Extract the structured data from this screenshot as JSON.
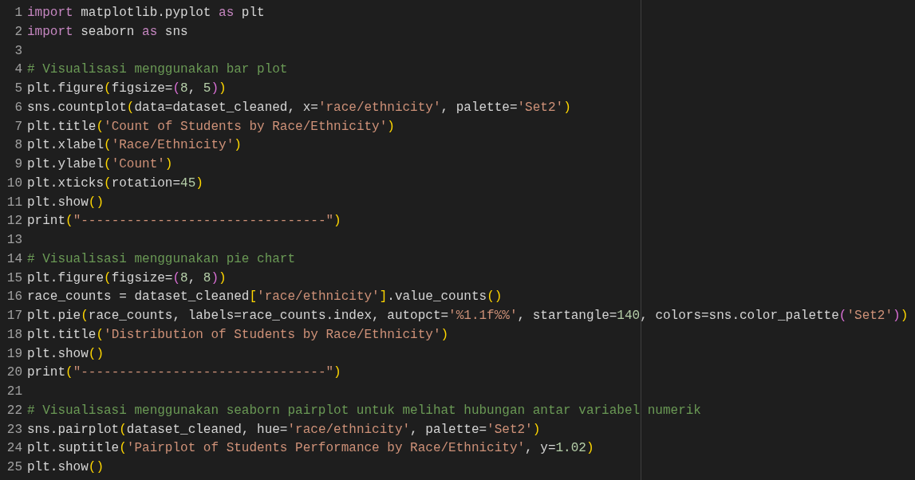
{
  "editor": {
    "lines": [
      {
        "number": "1",
        "tokens": [
          {
            "text": "import",
            "kind": "keyword"
          },
          {
            "text": " matplotlib.pyplot ",
            "kind": "plain"
          },
          {
            "text": "as",
            "kind": "keyword"
          },
          {
            "text": " plt",
            "kind": "plain"
          }
        ]
      },
      {
        "number": "2",
        "tokens": [
          {
            "text": "import",
            "kind": "keyword"
          },
          {
            "text": " seaborn ",
            "kind": "plain"
          },
          {
            "text": "as",
            "kind": "keyword"
          },
          {
            "text": " sns",
            "kind": "plain"
          }
        ]
      },
      {
        "number": "3"
      },
      {
        "number": "4",
        "tokens": [
          {
            "text": "# Visualisasi menggunakan bar plot",
            "kind": "comment"
          }
        ]
      },
      {
        "number": "5",
        "tokens": [
          {
            "text": "plt.figure",
            "kind": "plain"
          },
          {
            "text": "(",
            "kind": "paren"
          },
          {
            "text": "figsize=",
            "kind": "plain"
          },
          {
            "text": "(",
            "kind": "subparen"
          },
          {
            "text": "8",
            "kind": "number"
          },
          {
            "text": ", ",
            "kind": "plain"
          },
          {
            "text": "5",
            "kind": "number"
          },
          {
            "text": ")",
            "kind": "subparen"
          },
          {
            "text": ")",
            "kind": "paren"
          }
        ]
      },
      {
        "number": "6",
        "tokens": [
          {
            "text": "sns.countplot",
            "kind": "plain"
          },
          {
            "text": "(",
            "kind": "paren"
          },
          {
            "text": "data=dataset_cleaned, x=",
            "kind": "plain"
          },
          {
            "text": "'race/ethnicity'",
            "kind": "string"
          },
          {
            "text": ", palette=",
            "kind": "plain"
          },
          {
            "text": "'Set2'",
            "kind": "string"
          },
          {
            "text": ")",
            "kind": "paren"
          }
        ]
      },
      {
        "number": "7",
        "tokens": [
          {
            "text": "plt.title",
            "kind": "plain"
          },
          {
            "text": "(",
            "kind": "paren"
          },
          {
            "text": "'Count of Students by Race/Ethnicity'",
            "kind": "string"
          },
          {
            "text": ")",
            "kind": "paren"
          }
        ]
      },
      {
        "number": "8",
        "tokens": [
          {
            "text": "plt.xlabel",
            "kind": "plain"
          },
          {
            "text": "(",
            "kind": "paren"
          },
          {
            "text": "'Race/Ethnicity'",
            "kind": "string"
          },
          {
            "text": ")",
            "kind": "paren"
          }
        ]
      },
      {
        "number": "9",
        "tokens": [
          {
            "text": "plt.ylabel",
            "kind": "plain"
          },
          {
            "text": "(",
            "kind": "paren"
          },
          {
            "text": "'Count'",
            "kind": "string"
          },
          {
            "text": ")",
            "kind": "paren"
          }
        ]
      },
      {
        "number": "10",
        "tokens": [
          {
            "text": "plt.xticks",
            "kind": "plain"
          },
          {
            "text": "(",
            "kind": "paren"
          },
          {
            "text": "rotation=",
            "kind": "plain"
          },
          {
            "text": "45",
            "kind": "number"
          },
          {
            "text": ")",
            "kind": "paren"
          }
        ]
      },
      {
        "number": "11",
        "tokens": [
          {
            "text": "plt.show",
            "kind": "plain"
          },
          {
            "text": "()",
            "kind": "paren"
          }
        ]
      },
      {
        "number": "12",
        "tokens": [
          {
            "text": "print",
            "kind": "plain"
          },
          {
            "text": "(",
            "kind": "paren"
          },
          {
            "text": "\"--------------------------------\"",
            "kind": "string"
          },
          {
            "text": ")",
            "kind": "paren"
          }
        ]
      },
      {
        "number": "13"
      },
      {
        "number": "14",
        "tokens": [
          {
            "text": "# Visualisasi menggunakan pie chart",
            "kind": "comment"
          }
        ]
      },
      {
        "number": "15",
        "tokens": [
          {
            "text": "plt.figure",
            "kind": "plain"
          },
          {
            "text": "(",
            "kind": "paren"
          },
          {
            "text": "figsize=",
            "kind": "plain"
          },
          {
            "text": "(",
            "kind": "subparen"
          },
          {
            "text": "8",
            "kind": "number"
          },
          {
            "text": ", ",
            "kind": "plain"
          },
          {
            "text": "8",
            "kind": "number"
          },
          {
            "text": ")",
            "kind": "subparen"
          },
          {
            "text": ")",
            "kind": "paren"
          }
        ]
      },
      {
        "number": "16",
        "tokens": [
          {
            "text": "race_counts = dataset_cleaned",
            "kind": "plain"
          },
          {
            "text": "[",
            "kind": "paren"
          },
          {
            "text": "'race/ethnicity'",
            "kind": "string"
          },
          {
            "text": "]",
            "kind": "paren"
          },
          {
            "text": ".value_counts",
            "kind": "plain"
          },
          {
            "text": "()",
            "kind": "paren"
          }
        ]
      },
      {
        "number": "17",
        "tokens": [
          {
            "text": "plt.pie",
            "kind": "plain"
          },
          {
            "text": "(",
            "kind": "paren"
          },
          {
            "text": "race_counts, labels=race_counts.index, autopct=",
            "kind": "plain"
          },
          {
            "text": "'%1.1f%%'",
            "kind": "string"
          },
          {
            "text": ", startangle=",
            "kind": "plain"
          },
          {
            "text": "140",
            "kind": "number"
          },
          {
            "text": ", colors=sns.color_palette",
            "kind": "plain"
          },
          {
            "text": "(",
            "kind": "subparen"
          },
          {
            "text": "'Set2'",
            "kind": "string"
          },
          {
            "text": ")",
            "kind": "subparen"
          },
          {
            "text": ")",
            "kind": "paren"
          }
        ]
      },
      {
        "number": "18",
        "tokens": [
          {
            "text": "plt.title",
            "kind": "plain"
          },
          {
            "text": "(",
            "kind": "paren"
          },
          {
            "text": "'Distribution of Students by Race/Ethnicity'",
            "kind": "string"
          },
          {
            "text": ")",
            "kind": "paren"
          }
        ]
      },
      {
        "number": "19",
        "tokens": [
          {
            "text": "plt.show",
            "kind": "plain"
          },
          {
            "text": "()",
            "kind": "paren"
          }
        ]
      },
      {
        "number": "20",
        "tokens": [
          {
            "text": "print",
            "kind": "plain"
          },
          {
            "text": "(",
            "kind": "paren"
          },
          {
            "text": "\"--------------------------------\"",
            "kind": "string"
          },
          {
            "text": ")",
            "kind": "paren"
          }
        ]
      },
      {
        "number": "21"
      },
      {
        "number": "22",
        "tokens": [
          {
            "text": "# Visualisasi menggunakan seaborn pairplot untuk melihat hubungan antar variabel numerik",
            "kind": "comment"
          }
        ]
      },
      {
        "number": "23",
        "tokens": [
          {
            "text": "sns.pairplot",
            "kind": "plain"
          },
          {
            "text": "(",
            "kind": "paren"
          },
          {
            "text": "dataset_cleaned, hue=",
            "kind": "plain"
          },
          {
            "text": "'race/ethnicity'",
            "kind": "string"
          },
          {
            "text": ", palette=",
            "kind": "plain"
          },
          {
            "text": "'Set2'",
            "kind": "string"
          },
          {
            "text": ")",
            "kind": "paren"
          }
        ]
      },
      {
        "number": "24",
        "tokens": [
          {
            "text": "plt.suptitle",
            "kind": "plain"
          },
          {
            "text": "(",
            "kind": "paren"
          },
          {
            "text": "'Pairplot of Students Performance by Race/Ethnicity'",
            "kind": "string"
          },
          {
            "text": ", y=",
            "kind": "plain"
          },
          {
            "text": "1.02",
            "kind": "number"
          },
          {
            "text": ")",
            "kind": "paren"
          }
        ]
      },
      {
        "number": "25",
        "tokens": [
          {
            "text": "plt.show",
            "kind": "plain"
          },
          {
            "text": "()",
            "kind": "paren"
          }
        ]
      }
    ]
  }
}
